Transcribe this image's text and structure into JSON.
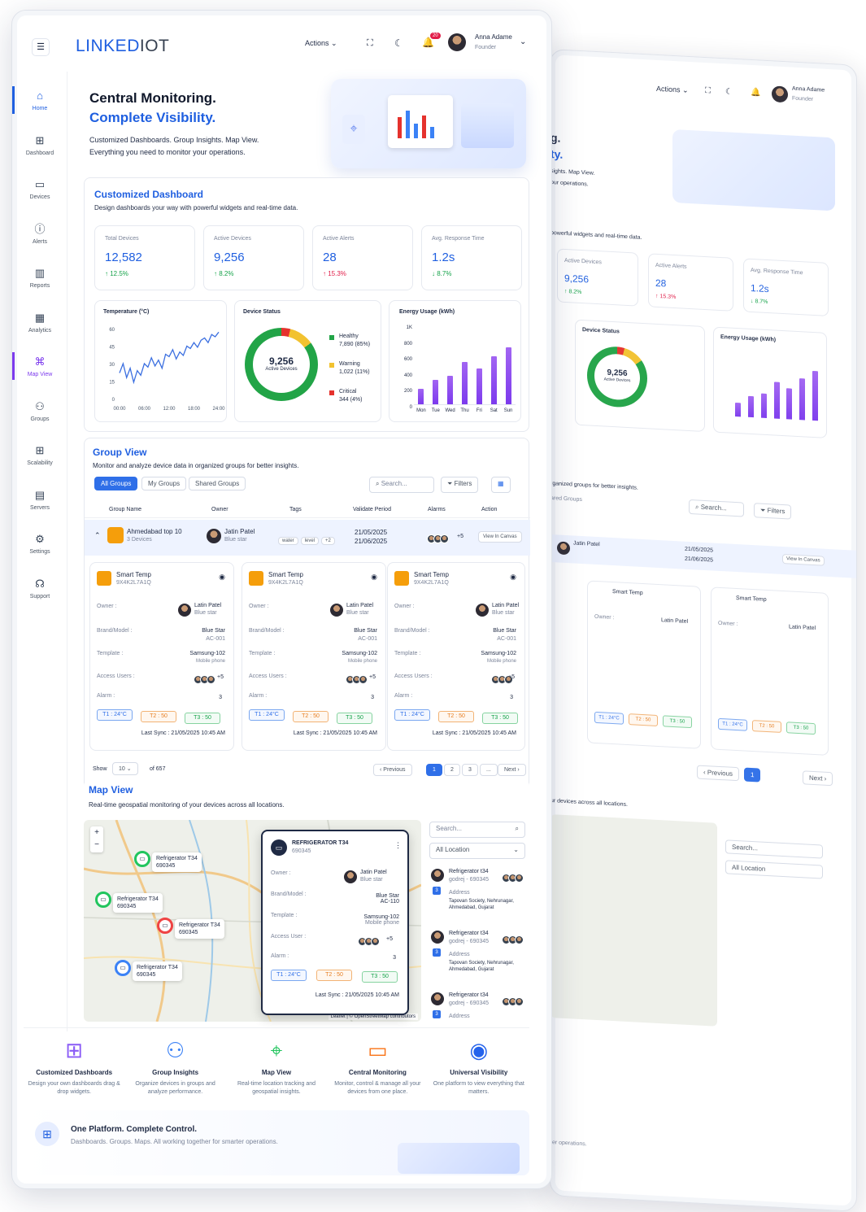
{
  "brand": {
    "part1": "LINKED",
    "part2": "IOT"
  },
  "header": {
    "actions": "Actions",
    "user_name": "Anna Adame",
    "user_role": "Founder",
    "notif_count": "20"
  },
  "sidebar": [
    {
      "label": "Home",
      "icon": "home-icon",
      "glyph": "⌂"
    },
    {
      "label": "Dashboard",
      "icon": "dashboard-icon",
      "glyph": "⊞"
    },
    {
      "label": "Devices",
      "icon": "devices-icon",
      "glyph": "▭"
    },
    {
      "label": "Alerts",
      "icon": "alert-icon",
      "glyph": "ⓘ"
    },
    {
      "label": "Reports",
      "icon": "reports-icon",
      "glyph": "▥"
    },
    {
      "label": "Analytics",
      "icon": "analytics-icon",
      "glyph": "▦"
    },
    {
      "label": "Map View",
      "icon": "map-icon",
      "glyph": "⌘"
    },
    {
      "label": "Groups",
      "icon": "groups-icon",
      "glyph": "⚇"
    },
    {
      "label": "Scalability",
      "icon": "scalability-icon",
      "glyph": "⊞"
    },
    {
      "label": "Servers",
      "icon": "servers-icon",
      "glyph": "▤"
    },
    {
      "label": "Settings",
      "icon": "settings-icon",
      "glyph": "⚙"
    },
    {
      "label": "Support",
      "icon": "support-icon",
      "glyph": "☊"
    }
  ],
  "hero": {
    "title1": "Central Monitoring.",
    "title2": "Complete Visibility.",
    "sub1": "Customized Dashboards. Group Insights. Map View.",
    "sub2": "Everything you need to monitor your operations."
  },
  "dashboard": {
    "title": "Customized Dashboard",
    "subtitle": "Design dashboards your way with powerful widgets and real-time data.",
    "stats": [
      {
        "label": "Total Devices",
        "value": "12,582",
        "change": "↑ 12.5%",
        "color": "green"
      },
      {
        "label": "Active Devices",
        "value": "9,256",
        "change": "↑ 8.2%",
        "color": "green"
      },
      {
        "label": "Active Alerts",
        "value": "28",
        "change": "↑ 15.3%",
        "color": "red"
      },
      {
        "label": "Avg. Response Time",
        "value": "1.2s",
        "change": "↓ 8.7%",
        "color": "green"
      }
    ]
  },
  "chart_data": [
    {
      "type": "line",
      "title": "Temperature (°C)",
      "x": [
        "00:00",
        "06:00",
        "12:00",
        "18:00",
        "24:00"
      ],
      "ylim": [
        0,
        60
      ],
      "yticks": [
        "60",
        "45",
        "30",
        "15",
        "0"
      ],
      "values": [
        22,
        30,
        18,
        26,
        14,
        24,
        20,
        30,
        27,
        35,
        28,
        33,
        26,
        38,
        36,
        42,
        34,
        40,
        37,
        45,
        43,
        48,
        44,
        50,
        52,
        48,
        55,
        53,
        57
      ]
    },
    {
      "type": "pie",
      "title": "Device Status",
      "center_value": "9,256",
      "center_label": "Active Devices",
      "series": [
        {
          "name": "Healthy",
          "detail": "7,890 (85%)",
          "value": 85,
          "color": "#22a447"
        },
        {
          "name": "Warning",
          "detail": "1,022 (11%)",
          "value": 11,
          "color": "#f2c230"
        },
        {
          "name": "Critical",
          "detail": "344 (4%)",
          "value": 4,
          "color": "#e5322d"
        }
      ]
    },
    {
      "type": "bar",
      "title": "Energy Usage (kWh)",
      "categories": [
        "Mon",
        "Tue",
        "Wed",
        "Thu",
        "Fri",
        "Sat",
        "Sun"
      ],
      "values": [
        210,
        330,
        380,
        560,
        480,
        640,
        760
      ],
      "ylim": [
        0,
        1000
      ],
      "yticks": [
        "1K",
        "800",
        "600",
        "400",
        "200",
        "0"
      ]
    }
  ],
  "group": {
    "title": "Group View",
    "subtitle": "Monitor and analyze device data in organized groups for better insights.",
    "tabs": [
      "All Groups",
      "My Groups",
      "Shared Groups"
    ],
    "search_placeholder": "Search...",
    "filters": "Filters",
    "columns": [
      "Group Name",
      "Owner",
      "Tags",
      "Validate Period",
      "Alarms",
      "Action"
    ],
    "row": {
      "name": "Ahmedabad top 10",
      "devices": "3 Devices",
      "owner": "Jatin Patel",
      "owner_role": "Blue star",
      "tags": [
        "water",
        "level",
        "+2"
      ],
      "period1": "21/05/2025",
      "period2": "21/06/2025",
      "alarms_more": "+5",
      "action": "View In Canvas"
    },
    "device_card": {
      "name": "Smart Temp",
      "id": "9X4K2L7A1Q",
      "owner_label": "Owner :",
      "owner": "Latin Patel",
      "owner_role": "Blue star",
      "brand_label": "Brand/Model :",
      "brand": "Blue Star",
      "model": "AC-001",
      "template_label": "Template :",
      "template": "Samsung-102",
      "template_sub": "Mobile phone",
      "access_label": "Access Users :",
      "access_more": "+5",
      "alarm_label": "Alarm :",
      "alarm": "3",
      "t1": "T1 : 24°C",
      "t2": "T2 : 50",
      "t3": "T3 : 50",
      "sync": "Last Sync : 21/05/2025 10:45 AM"
    },
    "show": "Show",
    "per_page": "10",
    "of": "of 657",
    "prev": "‹ Previous",
    "pages": [
      "1",
      "2",
      "3",
      "..."
    ],
    "next": "Next ›"
  },
  "map": {
    "title": "Map View",
    "subtitle": "Real-time geospatial monitoring of your devices across all locations.",
    "markers": [
      {
        "name": "Refrigerator T34",
        "id": "690345"
      },
      {
        "name": "Refrigerator T34",
        "id": "690345"
      },
      {
        "name": "Refrigerator T34",
        "id": "690345"
      },
      {
        "name": "Refrigerator T34",
        "id": "690345"
      }
    ],
    "popup": {
      "name": "REFRIGERATOR T34",
      "id": "690345",
      "owner_label": "Owner :",
      "owner": "Jatin Patel",
      "owner_role": "Blue star",
      "brand_label": "Brand/Model :",
      "brand": "Blue Star",
      "model": "AC-110",
      "template_label": "Template :",
      "template": "Samsung-102",
      "template_sub": "Mobile phone",
      "access_label": "Access User :",
      "access_more": "+5",
      "alarm_label": "Alarm :",
      "alarm": "3",
      "t1": "T1 : 24°C",
      "t2": "T2 : 50",
      "t3": "T3 : 50",
      "sync": "Last Sync : 21/05/2025 10:45 AM"
    },
    "search_placeholder": "Search...",
    "location": "All Location",
    "list": [
      {
        "name": "Refrigerator t34",
        "sub": "godrej - 690345",
        "address_label": "Address",
        "address": "Tapovan Society, Nehrunagar, Ahmedabad, Gujarat",
        "badge": "3"
      },
      {
        "name": "Refrigerator t34",
        "sub": "godrej - 690345",
        "address_label": "Address",
        "address": "Tapovan Society, Nehrunagar, Ahmedabad, Gujarat",
        "badge": "3"
      },
      {
        "name": "Refrigerator t34",
        "sub": "godrej - 690345",
        "address_label": "Address",
        "address": "",
        "badge": "3"
      }
    ],
    "attribution": "Leaflet | © OpenStreetMap contributors"
  },
  "features": [
    {
      "title": "Customized Dashboards",
      "desc": "Design your own dashboards drag & drop widgets.",
      "icon": "grid-icon",
      "glyph": "⊞",
      "color": "#8b5cf6"
    },
    {
      "title": "Group Insights",
      "desc": "Organize devices in groups and analyze performance.",
      "icon": "group-icon",
      "glyph": "⚇",
      "color": "#3b82f6"
    },
    {
      "title": "Map View",
      "desc": "Real-time location tracking and geospatial insights.",
      "icon": "pin-icon",
      "glyph": "⌖",
      "color": "#22c55e"
    },
    {
      "title": "Central Monitoring",
      "desc": "Monitor, control & manage all your devices from one place.",
      "icon": "monitor-icon",
      "glyph": "▭",
      "color": "#f97316"
    },
    {
      "title": "Universal Visibility",
      "desc": "One platform to view everything that matters.",
      "icon": "eye-icon",
      "glyph": "◉",
      "color": "#2563eb"
    }
  ],
  "footer": {
    "title": "One Platform. Complete Control.",
    "sub": "Dashboards. Groups. Maps. All working together for smarter operations."
  },
  "back": {
    "hero_frag1": "g.",
    "hero_frag2": "ty.",
    "hero_frag3": "sights. Map View.",
    "hero_frag4": "our operations.",
    "dash_frag": "powerful widgets and real-time data.",
    "group_frag": "rganized groups for better insights.",
    "map_frag": "ur devices across all locations.",
    "footer_frag": "ter operations.",
    "time_frag": "24:00",
    "shared_frag": "ared Groups"
  }
}
